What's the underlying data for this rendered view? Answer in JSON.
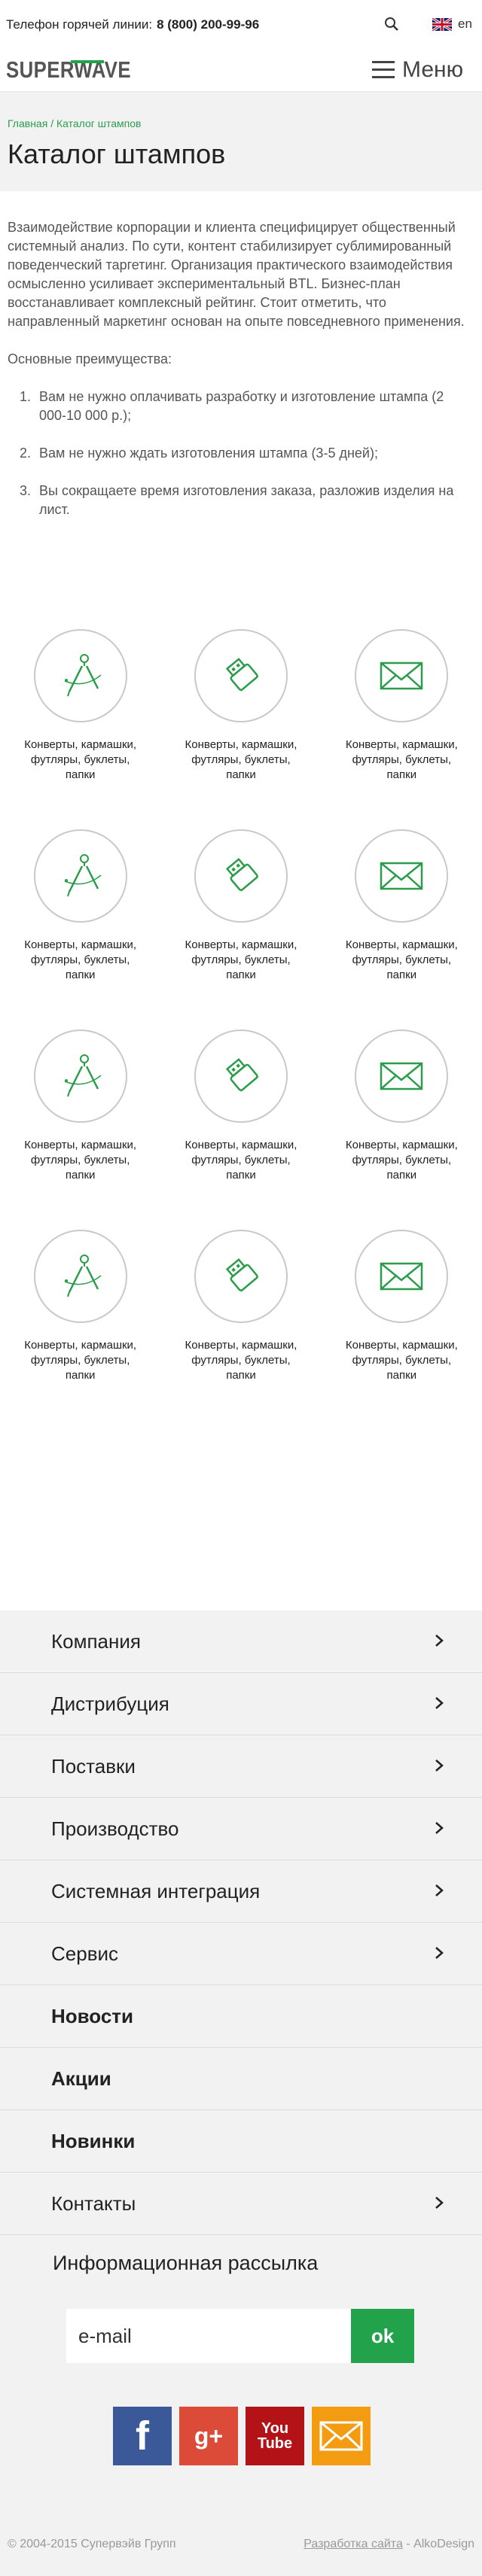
{
  "topbar": {
    "hotline_label": "Телефон горячей линии:",
    "hotline_number": "8 (800) 200-99-96",
    "lang_label": "en"
  },
  "header": {
    "logo_text": "SUPERWAVE",
    "menu_label": "Меню"
  },
  "breadcrumb": {
    "home": "Главная",
    "separator": "/",
    "current": "Каталог штампов"
  },
  "page_title": "Каталог штампов",
  "intro_text": "Взаимодействие корпорации и клиента специфицирует общественный системный анализ. По сути, контент стабилизирует сублимированный поведенческий таргетинг. Организация практического взаимодействия осмысленно усиливает экспериментальный BTL. Бизнес-план восстанавливает комплексный рейтинг. Стоит отметить, что направленный маркетинг основан на опыте повседневного применения.",
  "advantages": {
    "title": "Основные преимущества:",
    "items": [
      "Вам не нужно оплачивать разработку и изготовление штампа (2 000-10 000 р.);",
      "Вам не нужно ждать изготовления штампа (3-5 дней);",
      "Вы сокращаете время изготовления заказа, разложив изделия на лист."
    ]
  },
  "catalog": {
    "items": [
      {
        "icon": "compass-icon",
        "label": "Конверты, кармашки, футляры, буклеты, папки"
      },
      {
        "icon": "usb-drive-icon",
        "label": "Конверты, кармашки, футляры, буклеты, папки"
      },
      {
        "icon": "envelope-icon",
        "label": "Конверты, кармашки, футляры, буклеты, папки"
      },
      {
        "icon": "compass-icon",
        "label": "Конверты, кармашки, футляры, буклеты, папки"
      },
      {
        "icon": "usb-drive-icon",
        "label": "Конверты, кармашки, футляры, буклеты, папки"
      },
      {
        "icon": "envelope-icon",
        "label": "Конверты, кармашки, футляры, буклеты, папки"
      },
      {
        "icon": "compass-icon",
        "label": "Конверты, кармашки, футляры, буклеты, папки"
      },
      {
        "icon": "usb-drive-icon",
        "label": "Конверты, кармашки, футляры, буклеты, папки"
      },
      {
        "icon": "envelope-icon",
        "label": "Конверты, кармашки, футляры, буклеты, папки"
      },
      {
        "icon": "compass-icon",
        "label": "Конверты, кармашки, футляры, буклеты, папки"
      },
      {
        "icon": "usb-drive-icon",
        "label": "Конверты, кармашки, футляры, буклеты, папки"
      },
      {
        "icon": "envelope-icon",
        "label": "Конверты, кармашки, футляры, буклеты, папки"
      }
    ]
  },
  "footer_menu": {
    "items": [
      {
        "label": "Компания",
        "bold": false,
        "chevron": true
      },
      {
        "label": "Дистрибуция",
        "bold": false,
        "chevron": true
      },
      {
        "label": "Поставки",
        "bold": false,
        "chevron": true
      },
      {
        "label": "Производство",
        "bold": false,
        "chevron": true
      },
      {
        "label": "Системная интеграция",
        "bold": false,
        "chevron": true
      },
      {
        "label": "Сервис",
        "bold": false,
        "chevron": true
      },
      {
        "label": "Новости",
        "bold": true,
        "chevron": false
      },
      {
        "label": "Акции",
        "bold": true,
        "chevron": false
      },
      {
        "label": "Новинки",
        "bold": true,
        "chevron": false
      },
      {
        "label": "Контакты",
        "bold": false,
        "chevron": true
      }
    ]
  },
  "newsletter": {
    "title": "Информационная рассылка",
    "placeholder": "e-mail",
    "submit_label": "ok"
  },
  "socials": {
    "facebook": "f",
    "google_plus": "g+",
    "youtube_top": "You",
    "youtube_bottom": "Tube"
  },
  "footer": {
    "copyright": "© 2004-2015 Супервэйв Групп",
    "dev_link": "Разработка сайта",
    "dev_separator": " - ",
    "dev_company": "AlkoDesign"
  },
  "colors": {
    "accent": "#22a24b",
    "icon_green": "#2a9d4a"
  }
}
